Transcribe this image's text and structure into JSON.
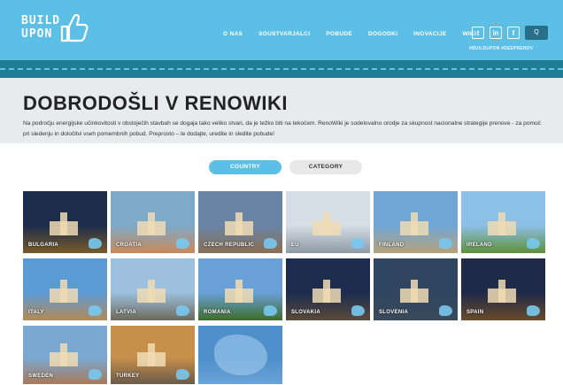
{
  "logo": {
    "line1": "BUILD",
    "line2": "UPON"
  },
  "nav": [
    "O NAS",
    "SOUSTVARJALCI",
    "POBUDE",
    "DOGODKI",
    "INOVACIJE",
    "WIKI"
  ],
  "social": {
    "twitter": "t",
    "linkedin": "in",
    "facebook": "f",
    "search": "Q"
  },
  "hashtags": "#BUILDUPON   #DEEPRENOV",
  "intro": {
    "title": "DOBRODOŠLI V RENOWIKI",
    "text": "Na področju energijske učinkovitosti v obstoječih stavbah se dogaja tako veliko stvari, da je težko biti na tekočem. RenoWiki je sodelovalno orodje za skupnost nacionalne strategije prenove - za pomoč pri sledenju in določitvi vseh pomembnih pobud. Preprosto – le dodajte, uredite in sledite pobude!"
  },
  "toggle": {
    "country": "COUNTRY",
    "category": "CATEGORY"
  },
  "countries": [
    {
      "label": "BULGARIA",
      "sky": "#1b2d4a",
      "land": "#7a5a2a"
    },
    {
      "label": "CROATIA",
      "sky": "#7fa9c9",
      "land": "#c98a5a"
    },
    {
      "label": "CZECH REPUBLIC",
      "sky": "#6a84a6",
      "land": "#8a6f52"
    },
    {
      "label": "EU",
      "sky": "#d5dde6",
      "land": "#8f9aa5"
    },
    {
      "label": "FINLAND",
      "sky": "#6fa6d6",
      "land": "#b7a27a"
    },
    {
      "label": "IRELAND",
      "sky": "#8cc0e6",
      "land": "#5f8f3a"
    },
    {
      "label": "ITALY",
      "sky": "#5c9ad6",
      "land": "#b58a55"
    },
    {
      "label": "LATVIA",
      "sky": "#9cc0de",
      "land": "#6d6a5a"
    },
    {
      "label": "ROMANIA",
      "sky": "#6aa0d8",
      "land": "#3f6d2a"
    },
    {
      "label": "SLOVAKIA",
      "sky": "#1c2b4e",
      "land": "#5a4a3a"
    },
    {
      "label": "SLOVENIA",
      "sky": "#2f4560",
      "land": "#3a4a5a"
    },
    {
      "label": "SPAIN",
      "sky": "#1e2a48",
      "land": "#6a4a2a"
    },
    {
      "label": "SWEDEN",
      "sky": "#7aa8d0",
      "land": "#a87a5a"
    },
    {
      "label": "TURKEY",
      "sky": "#c68f4a",
      "land": "#6a5a4a"
    },
    {
      "label": "",
      "sky": "#4f8fcb",
      "land": "#6aa3d6"
    }
  ]
}
